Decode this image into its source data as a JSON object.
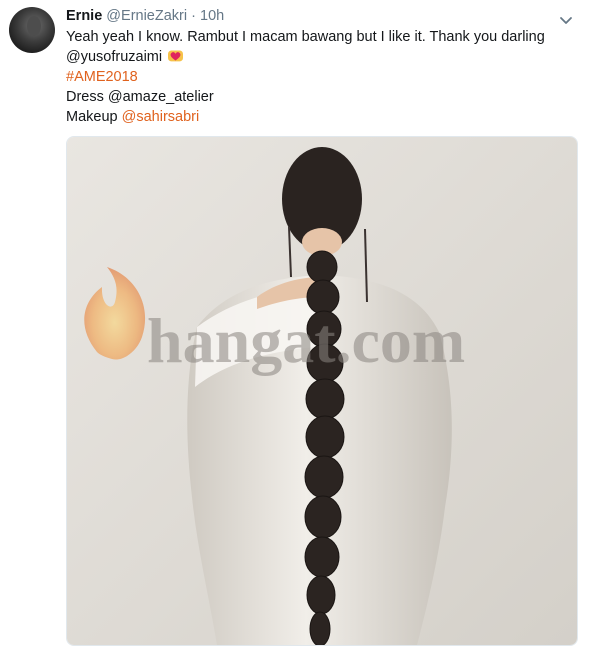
{
  "tweet": {
    "author_name": "Ernie",
    "author_handle": "@ErnieZakri",
    "separator": "·",
    "time": "10h",
    "line1": "Yeah yeah I know. Rambut I macam bawang but I like it. Thank you darling",
    "mention1": "@yusofruzaimi",
    "hashtag": "#AME2018",
    "dress_label": "Dress @amaze_atelier",
    "makeup_label": "Makeup ",
    "makeup_mention": "@sahirsabri"
  },
  "media": {
    "watermark": "hangat.com",
    "description_icon": "photo"
  },
  "icons": {
    "avatar": "user-avatar",
    "menu": "chevron-down-icon",
    "emoji": "heart-emoji-icon",
    "watermark_logo": "flame-icon"
  },
  "colors": {
    "link": "#e0621e",
    "text": "#14171a",
    "muted": "#657786"
  }
}
